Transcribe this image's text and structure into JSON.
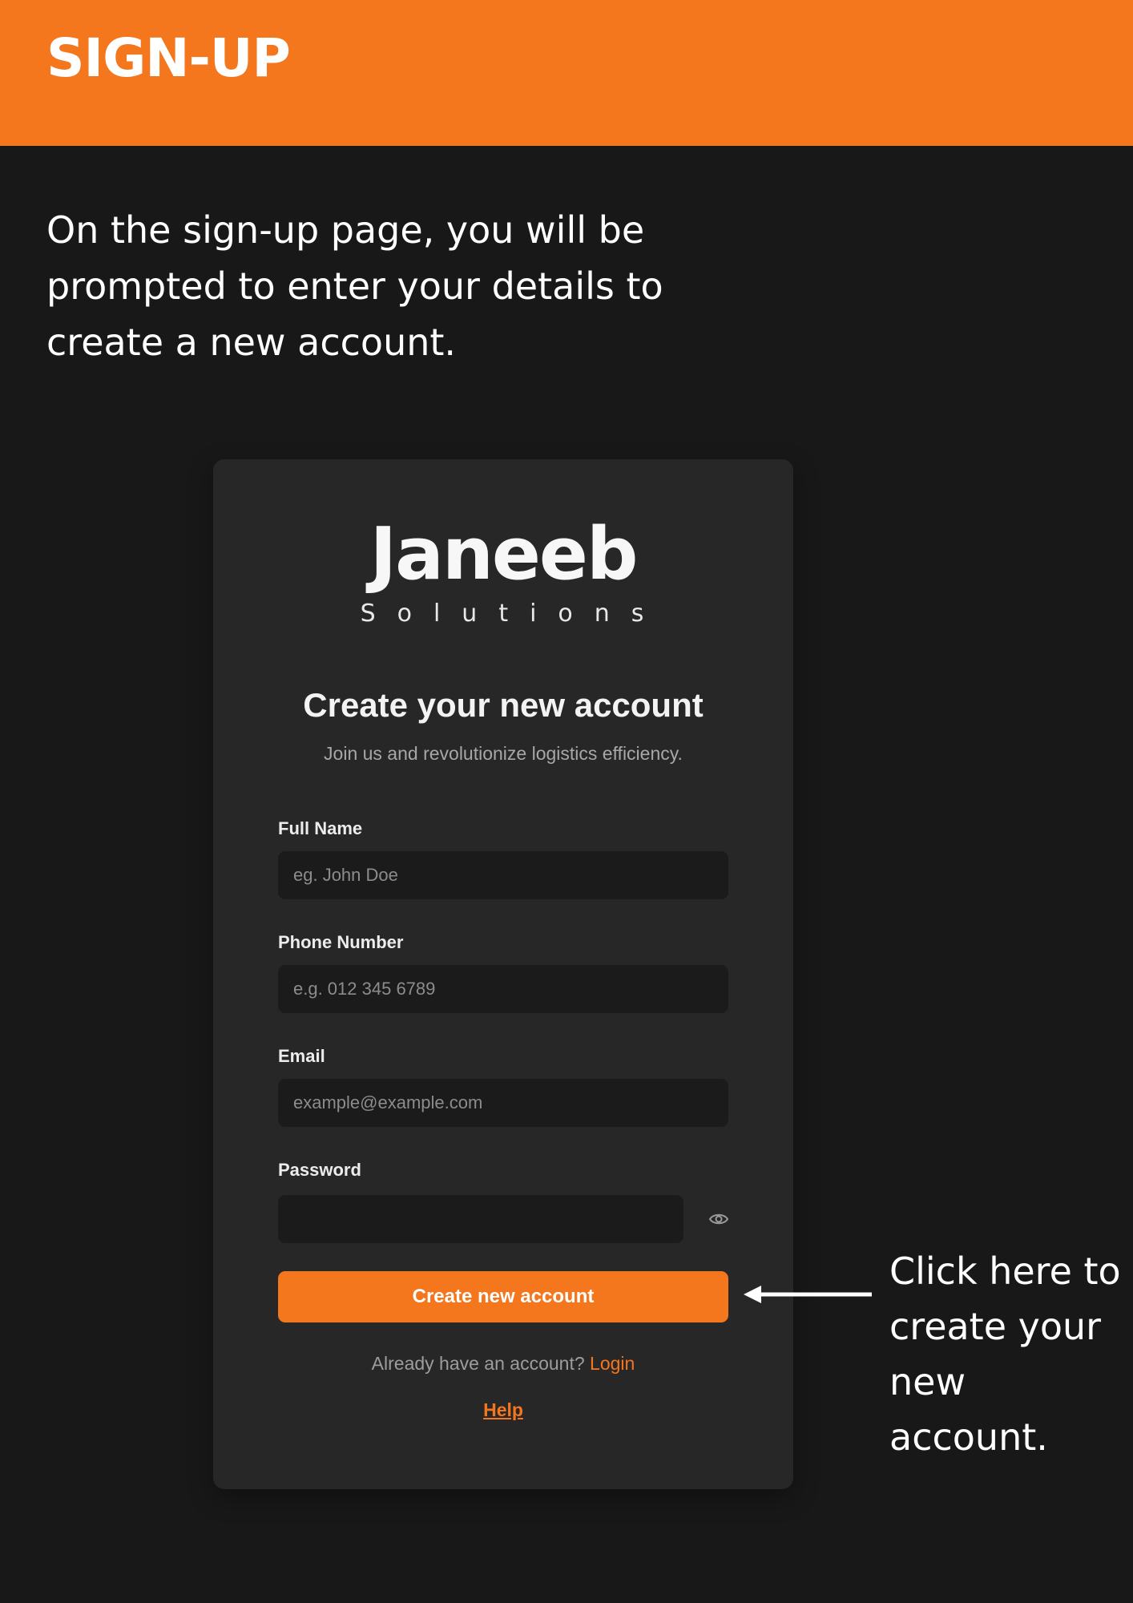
{
  "header": {
    "title": "SIGN-UP"
  },
  "intro": {
    "text": "On the sign-up page, you will be prompted to enter your details to create a new account."
  },
  "card": {
    "logo": {
      "name": "Janeeb",
      "tagline": "Solutions"
    },
    "title": "Create your new account",
    "subtitle": "Join us and revolutionize logistics efficiency.",
    "fields": [
      {
        "label": "Full Name",
        "placeholder": "eg. John Doe",
        "value": ""
      },
      {
        "label": "Phone Number",
        "placeholder": "e.g. 012 345 6789",
        "value": ""
      },
      {
        "label": "Email",
        "placeholder": "example@example.com",
        "value": ""
      },
      {
        "label": "Password",
        "placeholder": "",
        "value": ""
      }
    ],
    "password_toggle_icon": "eye-icon",
    "submit_label": "Create new account",
    "login_prompt": "Already have an account?",
    "login_link": "Login",
    "help_link": "Help"
  },
  "callout": {
    "text": "Click here to create your new account.",
    "arrow_icon": "arrow-left-icon"
  },
  "colors": {
    "accent": "#f4761d",
    "background": "#181818",
    "card": "#272727",
    "input": "#1b1b1b"
  }
}
